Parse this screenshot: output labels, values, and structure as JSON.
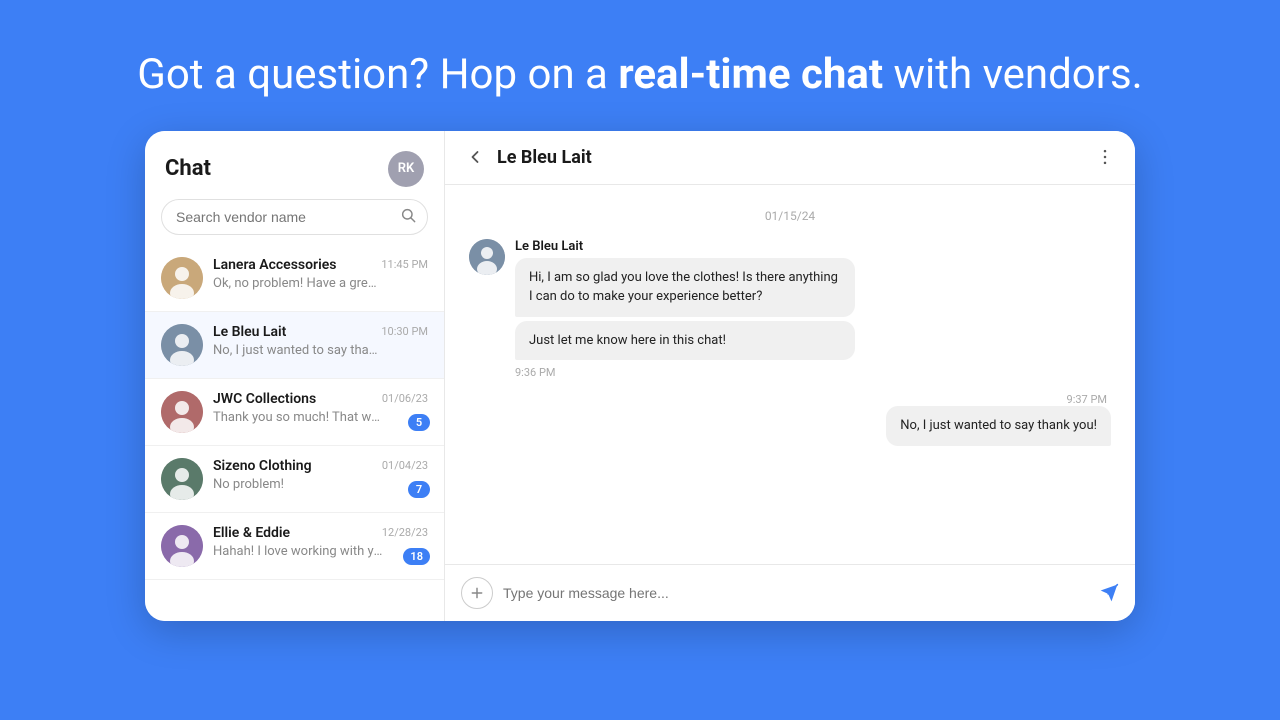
{
  "header": {
    "text_normal": "Got a question? Hop on a",
    "text_bold": "real-time chat",
    "text_end": "with vendors."
  },
  "chat_panel": {
    "title": "Chat",
    "user_initials": "RK",
    "search_placeholder": "Search vendor name",
    "vendors": [
      {
        "id": 1,
        "name": "Lanera Accessories",
        "preview": "Ok, no problem! Have a great day!",
        "time": "11:45 PM",
        "avatar_class": "av1",
        "badge": null,
        "active": false
      },
      {
        "id": 2,
        "name": "Le Bleu Lait",
        "preview": "No, I just wanted to say thank you!",
        "time": "10:30 PM",
        "avatar_class": "av2",
        "badge": null,
        "active": true
      },
      {
        "id": 3,
        "name": "JWC Collections",
        "preview": "Thank you so much! That was very helpful!",
        "time": "01/06/23",
        "avatar_class": "av3",
        "badge": "5",
        "active": false
      },
      {
        "id": 4,
        "name": "Sizeno Clothing",
        "preview": "No problem!",
        "time": "01/04/23",
        "avatar_class": "av4",
        "badge": "7",
        "active": false
      },
      {
        "id": 5,
        "name": "Ellie & Eddie",
        "preview": "Hahah! I love working with you Sasha!",
        "time": "12/28/23",
        "avatar_class": "av5",
        "badge": "18",
        "active": false
      }
    ]
  },
  "chat_window": {
    "vendor_name": "Le Bleu Lait",
    "date_divider": "01/15/24",
    "messages": [
      {
        "sender": "Le Bleu Lait",
        "type": "received",
        "bubbles": [
          "Hi, I am so glad you love the clothes! Is there anything I can do to make your experience better?",
          "Just let me know here in this chat!"
        ],
        "time": "9:36 PM",
        "time_position": "after_last"
      },
      {
        "sender": "me",
        "type": "sent",
        "bubbles": [
          "No, I just wanted to say thank you!"
        ],
        "time": "9:37 PM"
      }
    ],
    "input_placeholder": "Type your message here..."
  }
}
